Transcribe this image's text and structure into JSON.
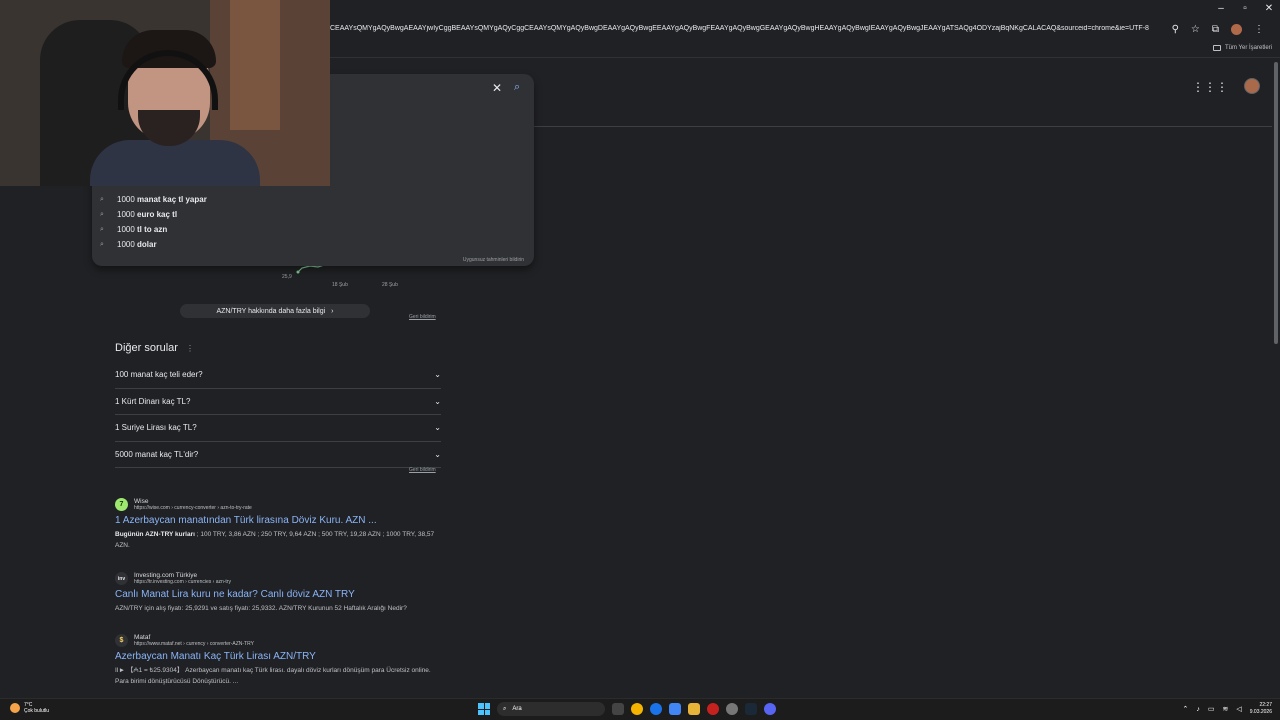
{
  "browser": {
    "url": "CEAAYsQMYgAQyBwgAEAAYjwIyCggBEAAYsQMYgAQyCggCEAAYsQMYgAQyBwgDEAAYgAQyBwgEEAAYgAQyBwgFEAAYgAQyBwgGEAAYgAQyBwgHEAAYgAQyBwgIEAAYgAQyBwgJEAAYgATSAQg4ODYzajBqNKgCALACAQ&sourceid=chrome&ie=UTF-8",
    "bookmarks_label": "Tüm Yer İşaretleri",
    "window_controls": [
      "–",
      "▫",
      "✕"
    ]
  },
  "search": {
    "clear_icon": "✕",
    "search_icon": "⌕",
    "suggestions": [
      {
        "prefix": "1000",
        "bold": " manat kaç tl yapar"
      },
      {
        "prefix": "1000",
        "bold": " euro kaç tl"
      },
      {
        "prefix": "1000",
        "bold": " tl to azn"
      },
      {
        "prefix": "1000",
        "bold": " dolar"
      }
    ],
    "report_label": "Uygunsuz tahminleri bildirin"
  },
  "chart": {
    "y_tick": "25,9",
    "x_ticks": [
      "18 Şub",
      "28 Şub"
    ],
    "more_info": "AZN/TRY hakkında daha fazla bilgi",
    "feedback": "Geri bildirim"
  },
  "paa": {
    "title": "Diğer sorular",
    "questions": [
      "100 manat kaç teli eder?",
      "1 Kürt Dinarı kaç TL?",
      "1 Suriye Lirası kaç TL?",
      "5000 manat kaç TL'dir?"
    ],
    "feedback": "Geri bildirim"
  },
  "results": [
    {
      "favicon": "7",
      "favicon_color": "#9fe870",
      "site": "Wise",
      "url": "https://wise.com › currency-converter › azn-to-try-rate",
      "title": "1 Azerbaycan manatından Türk lirasına Döviz Kuru. AZN ...",
      "snippet_bold": "Bugünün AZN-TRY kurları",
      "snippet": " ; 100 TRY, 3,86 AZN ; 250 TRY, 9,64 AZN ; 500 TRY, 19,28 AZN ; 1000 TRY, 38,57 AZN."
    },
    {
      "favicon": "inv",
      "favicon_color": "#303134",
      "site": "Investing.com Türkiye",
      "url": "https://tr.investing.com › currencies › azn-try",
      "title": "Canlı Manat Lira kuru ne kadar? Canlı döviz AZN TRY",
      "snippet_bold": "",
      "snippet": "AZN/TRY için alış fiyatı: 25,9291 ve satış fiyatı: 25,9332. AZN/TRY Kurunun 52 Haftalık Aralığı Nedir?"
    },
    {
      "favicon": "$",
      "favicon_color": "#303134",
      "site": "Mataf",
      "url": "https://www.mataf.net › currency › converter-AZN-TRY",
      "title": "Azerbaycan Manatı Kaç Türk Lirası AZN/TRY",
      "snippet_bold": "kaç Türk lirası",
      "snippet": "II► 【₼1 = ₺25.9304】 Azerbaycan manatı kaç Türk lirası. dayalı döviz kurları dönüşüm para Ücretsiz online. Para birimi dönüştürücüsü Dönüştürücü. ..."
    }
  ],
  "taskbar": {
    "weather_temp": "7°C",
    "weather_desc": "Çok bulutlu",
    "search_label": "Ara",
    "time": "22:27",
    "date": "9.03.2026"
  }
}
